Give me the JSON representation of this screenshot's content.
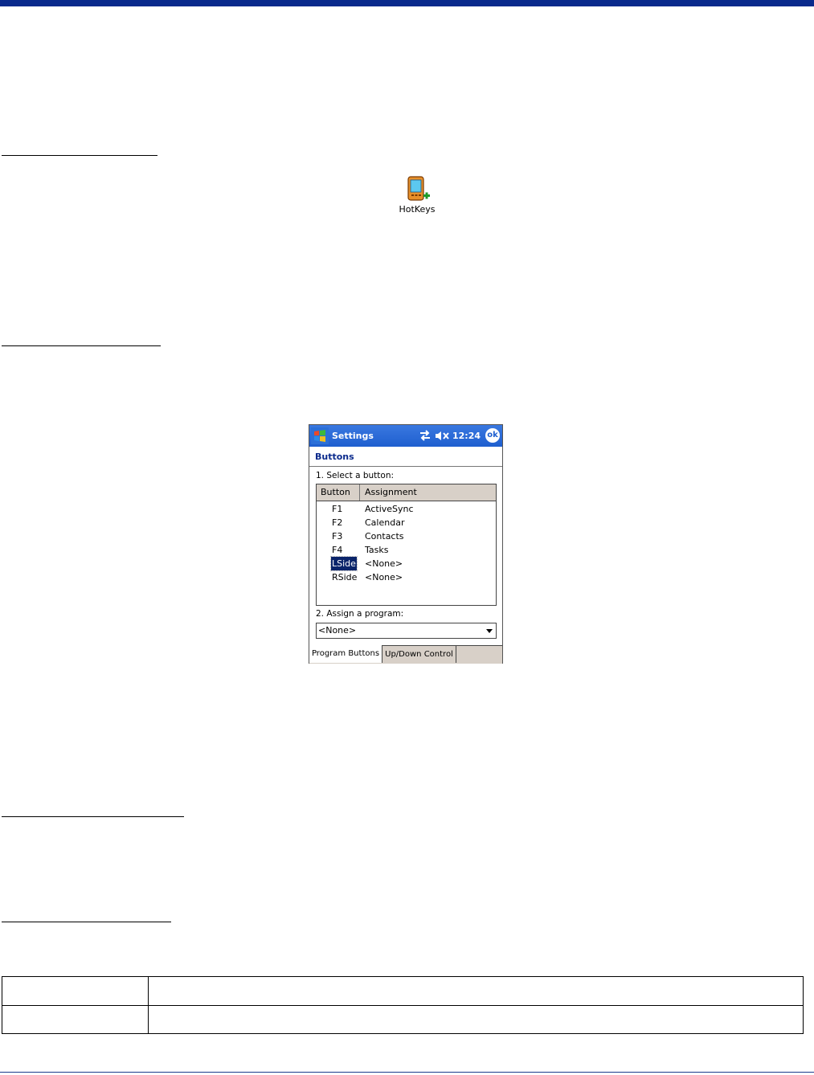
{
  "hotkeys_icon": {
    "label": "HotKeys",
    "icon": "device-plus-icon"
  },
  "ppc": {
    "title": "Settings",
    "clock": "12:24",
    "ok_label": "ok",
    "heading": "Buttons",
    "step1": "1. Select a button:",
    "columns": [
      "Button",
      "Assignment"
    ],
    "rows": [
      {
        "button": "F1",
        "assignment": "ActiveSync"
      },
      {
        "button": "F2",
        "assignment": "Calendar"
      },
      {
        "button": "F3",
        "assignment": "Contacts"
      },
      {
        "button": "F4",
        "assignment": "Tasks"
      },
      {
        "button": "LSide",
        "assignment": "<None>",
        "selected": true
      },
      {
        "button": "RSide",
        "assignment": "<None>"
      }
    ],
    "step2": "2. Assign a program:",
    "program_value": "<None>",
    "tabs": [
      "Program Buttons",
      "Up/Down Control"
    ]
  },
  "colors": {
    "title_bar": "#1e5fcf",
    "selection": "#0a246a",
    "header_bg": "#d8d0c8",
    "doc_bar": "#0a2a8c"
  }
}
